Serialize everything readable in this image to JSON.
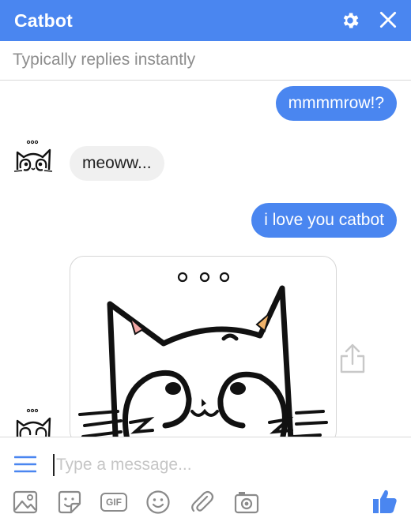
{
  "header": {
    "title": "Catbot",
    "settings_icon": "gear-icon",
    "close_icon": "close-icon",
    "background": "#4a86f0"
  },
  "subheader": {
    "status": "Typically replies instantly"
  },
  "messages": [
    {
      "sender": "user",
      "text": "mmmmrow!?"
    },
    {
      "sender": "bot",
      "text": "meoww..."
    },
    {
      "sender": "user",
      "text": "i love you catbot"
    },
    {
      "sender": "bot",
      "type": "image",
      "image": "cat-face-drawing"
    }
  ],
  "composer": {
    "placeholder": "Type a message...",
    "value": "",
    "tools": [
      "image-icon",
      "sticker-icon",
      "gif-icon",
      "emoji-icon",
      "attachment-icon",
      "camera-icon"
    ],
    "gif_label": "GIF",
    "send_icon": "thumbs-up-icon"
  },
  "colors": {
    "accent": "#4a86f0",
    "incoming_bubble": "#f0f0f0"
  }
}
